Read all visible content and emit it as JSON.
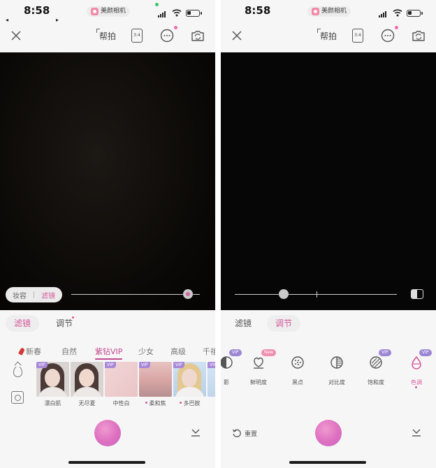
{
  "status": {
    "time": "8:58",
    "app_name": "美颜相机",
    "back_arrow": "◂",
    "forward_arrow": "▸"
  },
  "topbar": {
    "helper_label": "帮拍",
    "ratio_label": "3:4"
  },
  "left": {
    "segment": {
      "makeup": "妆容",
      "filter": "滤镜",
      "selected": "filter"
    },
    "slider_level": 0.91,
    "mode_tabs": {
      "filter": "滤镜",
      "adjust": "调节",
      "selected": "filter"
    },
    "categories": [
      "新春",
      "自然",
      "紫钻VIP",
      "少女",
      "高级",
      "千禧"
    ],
    "selected_category": "紫钻VIP",
    "filters": [
      {
        "label": "漂白肌",
        "badge": "VIP",
        "dot": false,
        "kind": "portrait"
      },
      {
        "label": "无尽夏",
        "badge": "",
        "dot": false,
        "kind": "portrait"
      },
      {
        "label": "中性白",
        "badge": "VIP",
        "dot": false,
        "kind": "pink"
      },
      {
        "label": "柔和焦",
        "badge": "VIP",
        "dot": true,
        "kind": "sunset"
      },
      {
        "label": "多巴胺",
        "badge": "VIP",
        "dot": true,
        "kind": "blonde"
      },
      {
        "label": "",
        "badge": "VIP",
        "dot": true,
        "kind": "blue"
      }
    ]
  },
  "right": {
    "slider_level": 0.3,
    "mode_tabs": {
      "filter": "滤镜",
      "adjust": "调节",
      "selected": "adjust"
    },
    "adjustments": [
      {
        "label": "影",
        "badge": "VIP",
        "icon": "shadow-icon",
        "selected": false
      },
      {
        "label": "鲜明度",
        "badge": "New",
        "icon": "vividness-icon",
        "selected": false
      },
      {
        "label": "黑点",
        "badge": "",
        "icon": "black-point-icon",
        "selected": false
      },
      {
        "label": "对比度",
        "badge": "",
        "icon": "contrast-icon",
        "selected": false
      },
      {
        "label": "饱和度",
        "badge": "VIP",
        "icon": "saturation-icon",
        "selected": false
      },
      {
        "label": "色调",
        "badge": "VIP",
        "icon": "tone-icon",
        "selected": true
      }
    ],
    "reset_label": "重置"
  },
  "colors": {
    "accent": "#d4589c",
    "vip": "#a889d8",
    "new": "#ef8fb0"
  }
}
